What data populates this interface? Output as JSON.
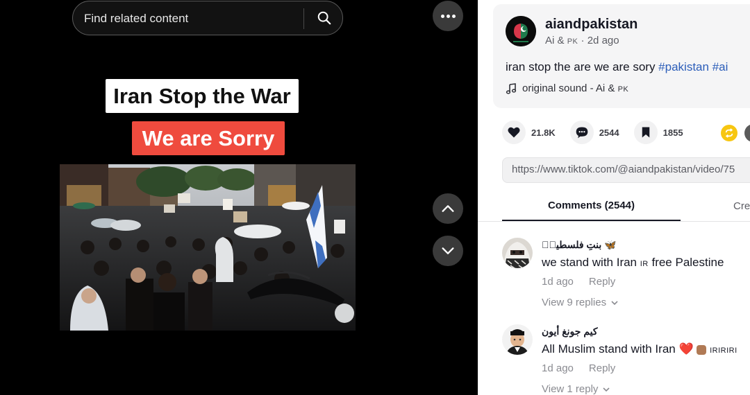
{
  "search": {
    "placeholder": "Find related content"
  },
  "video": {
    "caption_top": "Iran Stop the War",
    "caption_bottom": "We are Sorry",
    "colors": {
      "caption_red": "#ef4b3e",
      "caption_white": "#ffffff"
    }
  },
  "post": {
    "username": "aiandpakistan",
    "display_name": "Ai & ",
    "display_name_flag": "PK",
    "time_ago": "2d ago",
    "description": "iran stop the are we are sory ",
    "hashtags": [
      "#pakistan",
      "#ai"
    ],
    "sound_label": "original sound - Ai & ",
    "sound_flag": "PK"
  },
  "actions": {
    "likes": "21.8K",
    "comments": "2544",
    "saves": "1855"
  },
  "share_link": "https://www.tiktok.com/@aiandpakistan/video/75",
  "tabs": {
    "comments": "Comments (2544)",
    "creator": "Cre"
  },
  "comments": [
    {
      "name": "بنتِ فلسطینؔ",
      "name_emoji": "🦋",
      "text": "we stand with Iran ",
      "text_flag": "IR",
      "text_after": " free Palestine",
      "time": "1d ago",
      "reply_label": "Reply",
      "view_replies": "View 9 replies"
    },
    {
      "name": "كيم جونغ أيون",
      "text": "All Muslim stand with Iran ",
      "text_emoji": "❤️",
      "text_trailing": "IRIRIRI",
      "time": "1d ago",
      "reply_label": "Reply",
      "view_replies": "View 1 reply"
    }
  ],
  "icons": {
    "search": "search-icon",
    "more": "more-horizontal-icon",
    "up": "chevron-up-icon",
    "down": "chevron-down-icon",
    "heart": "heart-icon",
    "comment": "comment-icon",
    "bookmark": "bookmark-icon",
    "repost": "repost-icon",
    "music": "music-note-icon"
  }
}
